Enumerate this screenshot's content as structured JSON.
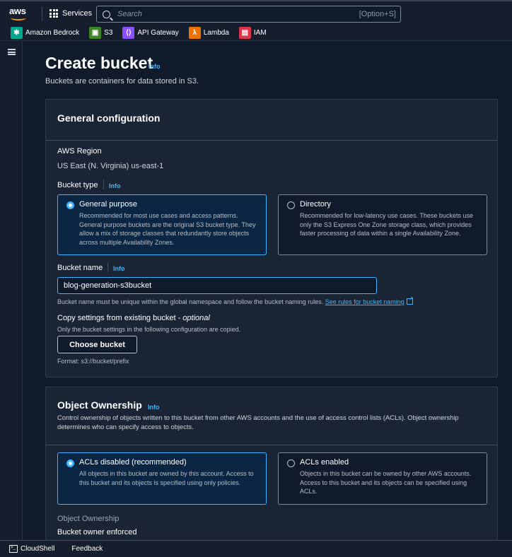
{
  "topnav": {
    "logo": "aws",
    "services_label": "Services",
    "search_placeholder": "Search",
    "search_shortcut": "[Option+S]"
  },
  "favorites": [
    {
      "label": "Amazon Bedrock",
      "icon": "bedrock-icon",
      "color": "#01a88d"
    },
    {
      "label": "S3",
      "icon": "s3-icon",
      "color": "#3f8624"
    },
    {
      "label": "API Gateway",
      "icon": "api-gateway-icon",
      "color": "#8c4fff"
    },
    {
      "label": "Lambda",
      "icon": "lambda-icon",
      "color": "#ed7100"
    },
    {
      "label": "IAM",
      "icon": "iam-icon",
      "color": "#dd344c"
    }
  ],
  "page": {
    "title": "Create bucket",
    "title_info": "Info",
    "subtitle": "Buckets are containers for data stored in S3."
  },
  "general": {
    "heading": "General configuration",
    "region_label": "AWS Region",
    "region_value": "US East (N. Virginia) us-east-1",
    "bucket_type_label": "Bucket type",
    "bucket_type_info": "Info",
    "types": [
      {
        "title": "General purpose",
        "desc": "Recommended for most use cases and access patterns. General purpose buckets are the original S3 bucket type. They allow a mix of storage classes that redundantly store objects across multiple Availability Zones.",
        "selected": true
      },
      {
        "title": "Directory",
        "desc": "Recommended for low-latency use cases. These buckets use only the S3 Express One Zone storage class, which provides faster processing of data within a single Availability Zone.",
        "selected": false
      }
    ],
    "bucket_name_label": "Bucket name",
    "bucket_name_info": "Info",
    "bucket_name_value": "blog-generation-s3bucket",
    "bucket_name_hint": "Bucket name must be unique within the global namespace and follow the bucket naming rules.",
    "bucket_name_link": "See rules for bucket naming",
    "copy_label": "Copy settings from existing bucket - ",
    "copy_optional": "optional",
    "copy_hint": "Only the bucket settings in the following configuration are copied.",
    "choose_button": "Choose bucket",
    "format_hint": "Format: s3://bucket/prefix"
  },
  "ownership": {
    "heading": "Object Ownership",
    "heading_info": "Info",
    "desc": "Control ownership of objects written to this bucket from other AWS accounts and the use of access control lists (ACLs). Object ownership determines who can specify access to objects.",
    "options": [
      {
        "title": "ACLs disabled (recommended)",
        "desc": "All objects in this bucket are owned by this account. Access to this bucket and its objects is specified using only policies.",
        "selected": true
      },
      {
        "title": "ACLs enabled",
        "desc": "Objects in this bucket can be owned by other AWS accounts. Access to this bucket and its objects can be specified using ACLs.",
        "selected": false
      }
    ],
    "sub_label": "Object Ownership",
    "sub_value": "Bucket owner enforced"
  },
  "footer": {
    "cloudshell": "CloudShell",
    "feedback": "Feedback"
  }
}
